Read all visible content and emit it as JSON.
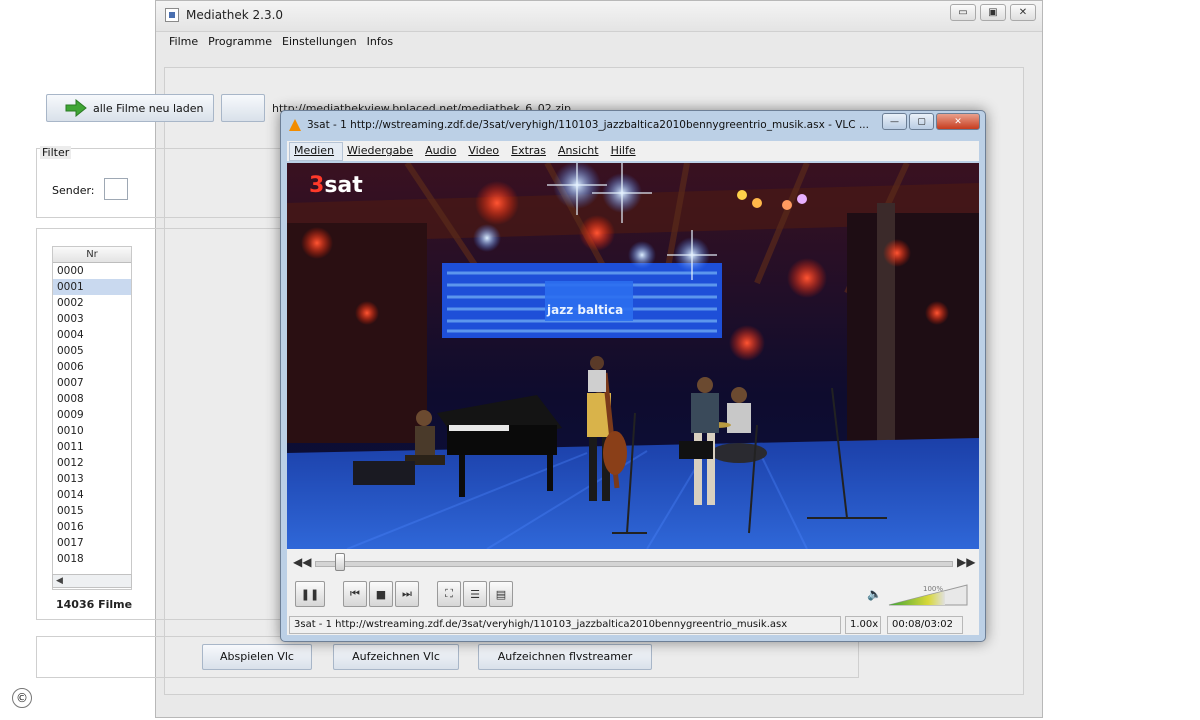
{
  "mediathek": {
    "title": "Mediathek 2.3.0",
    "menu": [
      "Filme",
      "Programme",
      "Einstellungen",
      "Infos"
    ],
    "load_button_label": "alle Filme neu laden",
    "url_text": "http://mediathekview.bplaced.net/mediathek_6_02.zip",
    "filter_label": "Filter",
    "sender_label": "Sender:",
    "table_header": "Nr",
    "rows": [
      "0000",
      "0001",
      "0002",
      "0003",
      "0004",
      "0005",
      "0006",
      "0007",
      "0008",
      "0009",
      "0010",
      "0011",
      "0012",
      "0013",
      "0014",
      "0015",
      "0016",
      "0017",
      "0018"
    ],
    "selected_row": "0001",
    "count_label": "14036 Filme",
    "buttons": [
      "Abspielen Vlc",
      "Aufzeichnen Vlc",
      "Aufzeichnen flvstreamer"
    ]
  },
  "vlc": {
    "title": "3sat - 1 http://wstreaming.zdf.de/3sat/veryhigh/110103_jazzbaltica2010bennygreentrio_musik.asx - VLC ...",
    "menu": [
      "Medien",
      "Wiedergabe",
      "Audio",
      "Video",
      "Extras",
      "Ansicht",
      "Hilfe"
    ],
    "channel_logo_num": "3",
    "channel_logo_text": "sat",
    "stage_screen_text": "jazz baltica",
    "seek_progress": 0.04,
    "volume_percent": "100%",
    "status_url": "3sat - 1 http://wstreaming.zdf.de/3sat/veryhigh/110103_jazzbaltica2010bennygreentrio_musik.asx",
    "speed": "1.00x",
    "time": "00:08/03:02"
  },
  "copyright_symbol": "©",
  "colors": {
    "accent_green": "#3fa535",
    "vlc_orange": "#f28c00",
    "selection_blue": "#c9d9ef"
  }
}
